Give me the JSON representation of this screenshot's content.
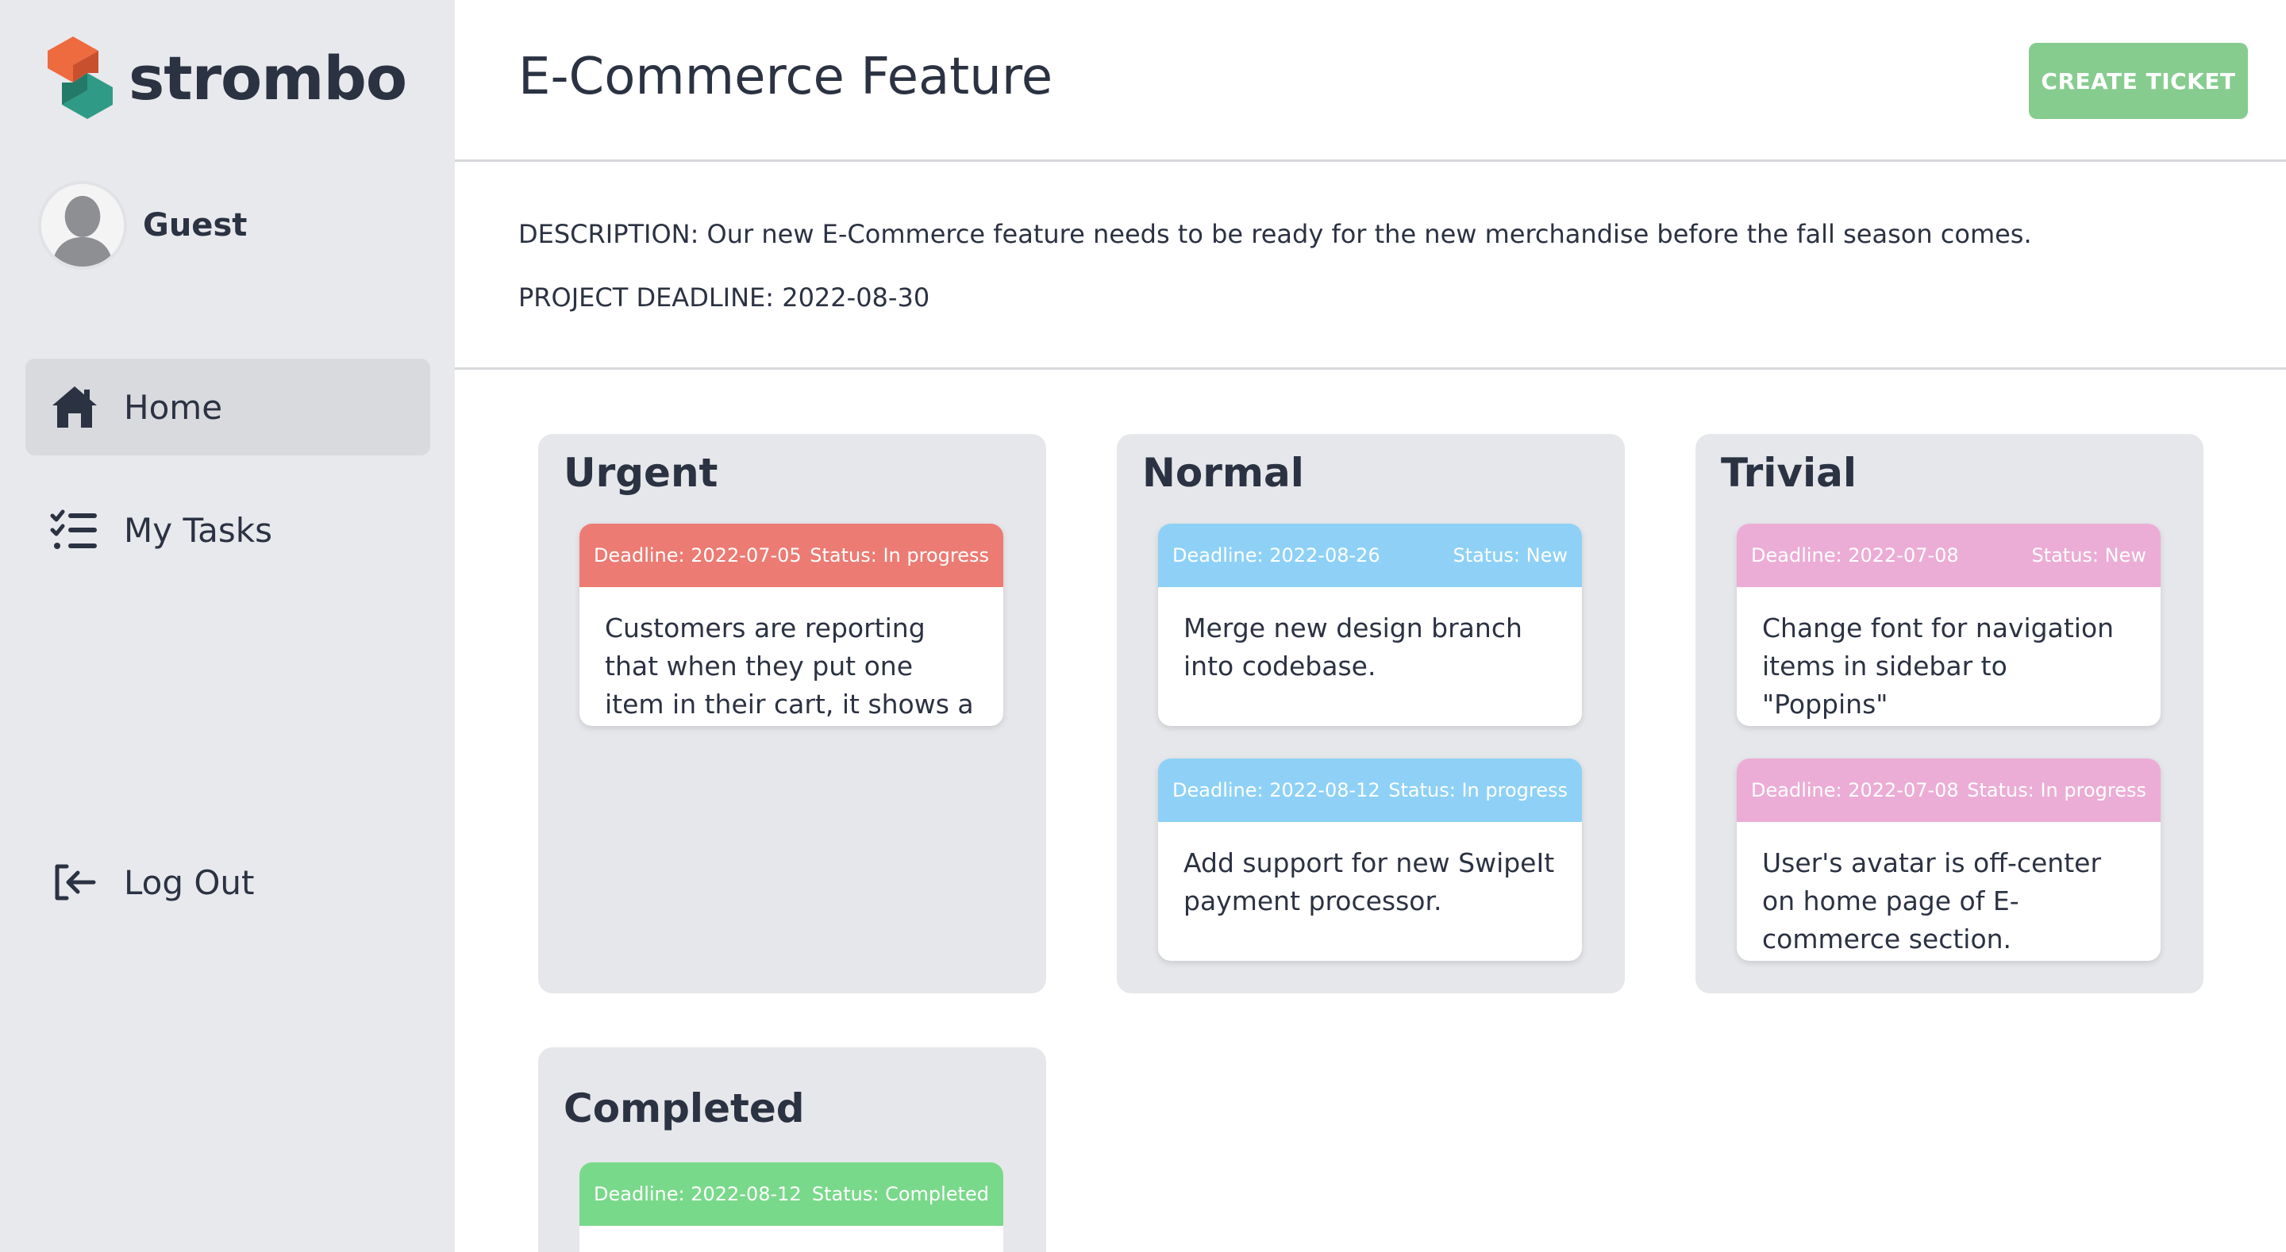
{
  "brand": {
    "name": "strombo",
    "colors": {
      "orange": "#ee6a3f",
      "teal": "#2f9b86"
    }
  },
  "user": {
    "name": "Guest"
  },
  "nav": {
    "home": "Home",
    "my_tasks": "My Tasks",
    "logout": "Log Out"
  },
  "header": {
    "title": "E-Commerce Feature",
    "create_button": "CREATE TICKET"
  },
  "project": {
    "description": "DESCRIPTION: Our new E-Commerce feature needs to be ready for the new merchandise before the fall season comes.",
    "deadline": "PROJECT DEADLINE: 2022-08-30"
  },
  "colors": {
    "urgent": "#ec7b73",
    "normal": "#8fd1f6",
    "trivial": "#ebadd5",
    "completed": "#79d98a",
    "create_button": "#86cc8f"
  },
  "columns": {
    "urgent": {
      "title": "Urgent",
      "tickets": [
        {
          "deadline": "Deadline: 2022-07-05",
          "status": "Status: In progress",
          "text": "Customers are reporting that when they put one item in their cart, it shows a quantity"
        }
      ]
    },
    "normal": {
      "title": "Normal",
      "tickets": [
        {
          "deadline": "Deadline: 2022-08-26",
          "status": "Status: New",
          "text": "Merge new design branch into codebase."
        },
        {
          "deadline": "Deadline: 2022-08-12",
          "status": "Status: In progress",
          "text": "Add support for new SwipeIt payment processor."
        }
      ]
    },
    "trivial": {
      "title": "Trivial",
      "tickets": [
        {
          "deadline": "Deadline: 2022-07-08",
          "status": "Status: New",
          "text": "Change font for navigation items in sidebar to \"Poppins\""
        },
        {
          "deadline": "Deadline: 2022-07-08",
          "status": "Status: In progress",
          "text": "User's avatar is off-center on home page of E-commerce section."
        }
      ]
    },
    "completed": {
      "title": "Completed",
      "tickets": [
        {
          "deadline": "Deadline: 2022-08-12",
          "status": "Status: Completed",
          "text": ""
        }
      ]
    }
  }
}
